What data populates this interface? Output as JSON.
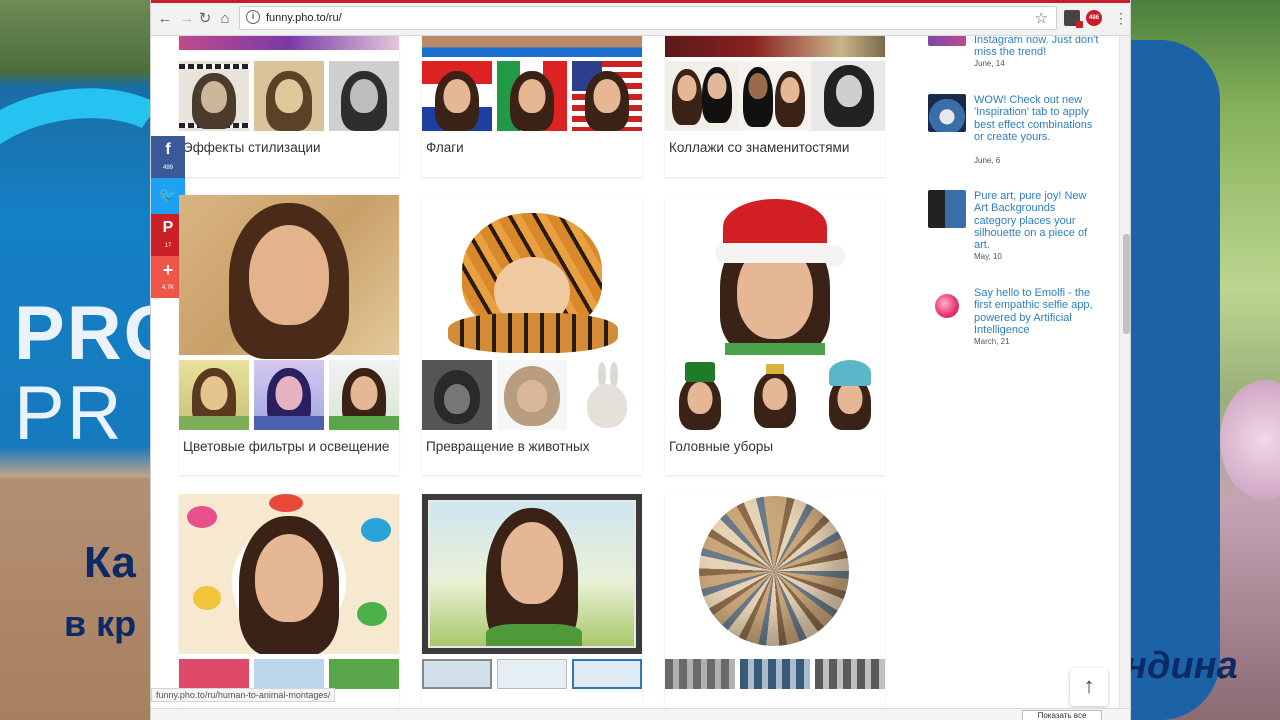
{
  "browser": {
    "url": "funny.pho.to/ru/",
    "status_url": "funny.pho.to/ru/human-to-animal-montages/",
    "ext_badge": "486",
    "show_all_label": "Показать все"
  },
  "background": {
    "left_text_1": "PRO",
    "left_text_2": "PR",
    "left_ru_1": "Ка",
    "left_ru_2": "в кр",
    "right_text": "ндина"
  },
  "social": [
    {
      "name": "facebook",
      "glyph": "f",
      "count": "499",
      "color": "#3b5998"
    },
    {
      "name": "twitter",
      "glyph": "🐦",
      "count": "",
      "color": "#1da1f2"
    },
    {
      "name": "pinterest",
      "glyph": "P",
      "count": "17",
      "color": "#cb2027"
    },
    {
      "name": "share",
      "glyph": "+",
      "count": "4.7K",
      "color": "#f0554a"
    }
  ],
  "cards": {
    "r1c1": {
      "title": "Эффекты стилизации"
    },
    "r1c2": {
      "title": "Флаги"
    },
    "r1c3": {
      "title": "Коллажи со знаменитостями"
    },
    "r2c1": {
      "title": "Цветовые фильтры и освещение"
    },
    "r2c2": {
      "title": "Превращение в животных"
    },
    "r2c3": {
      "title": "Головные уборы"
    }
  },
  "news": [
    {
      "text": "Instagram now. Just don't miss the trend!",
      "date": "June, 14"
    },
    {
      "text": "WOW! Check out new 'Inspiration' tab to apply best effect combinations or create yours.",
      "date": "June, 6"
    },
    {
      "text": "Pure art, pure joy! New Art Backgrounds category places your silhouette on a piece of art.",
      "date": "May, 10"
    },
    {
      "text": "Say hello to Emolfi - the first empathic selfie app, powered by Artificial Intelligence",
      "date": "March, 21"
    }
  ],
  "colors": {
    "accent_red": "#c81e2a",
    "link_blue": "#2e7fc1"
  }
}
